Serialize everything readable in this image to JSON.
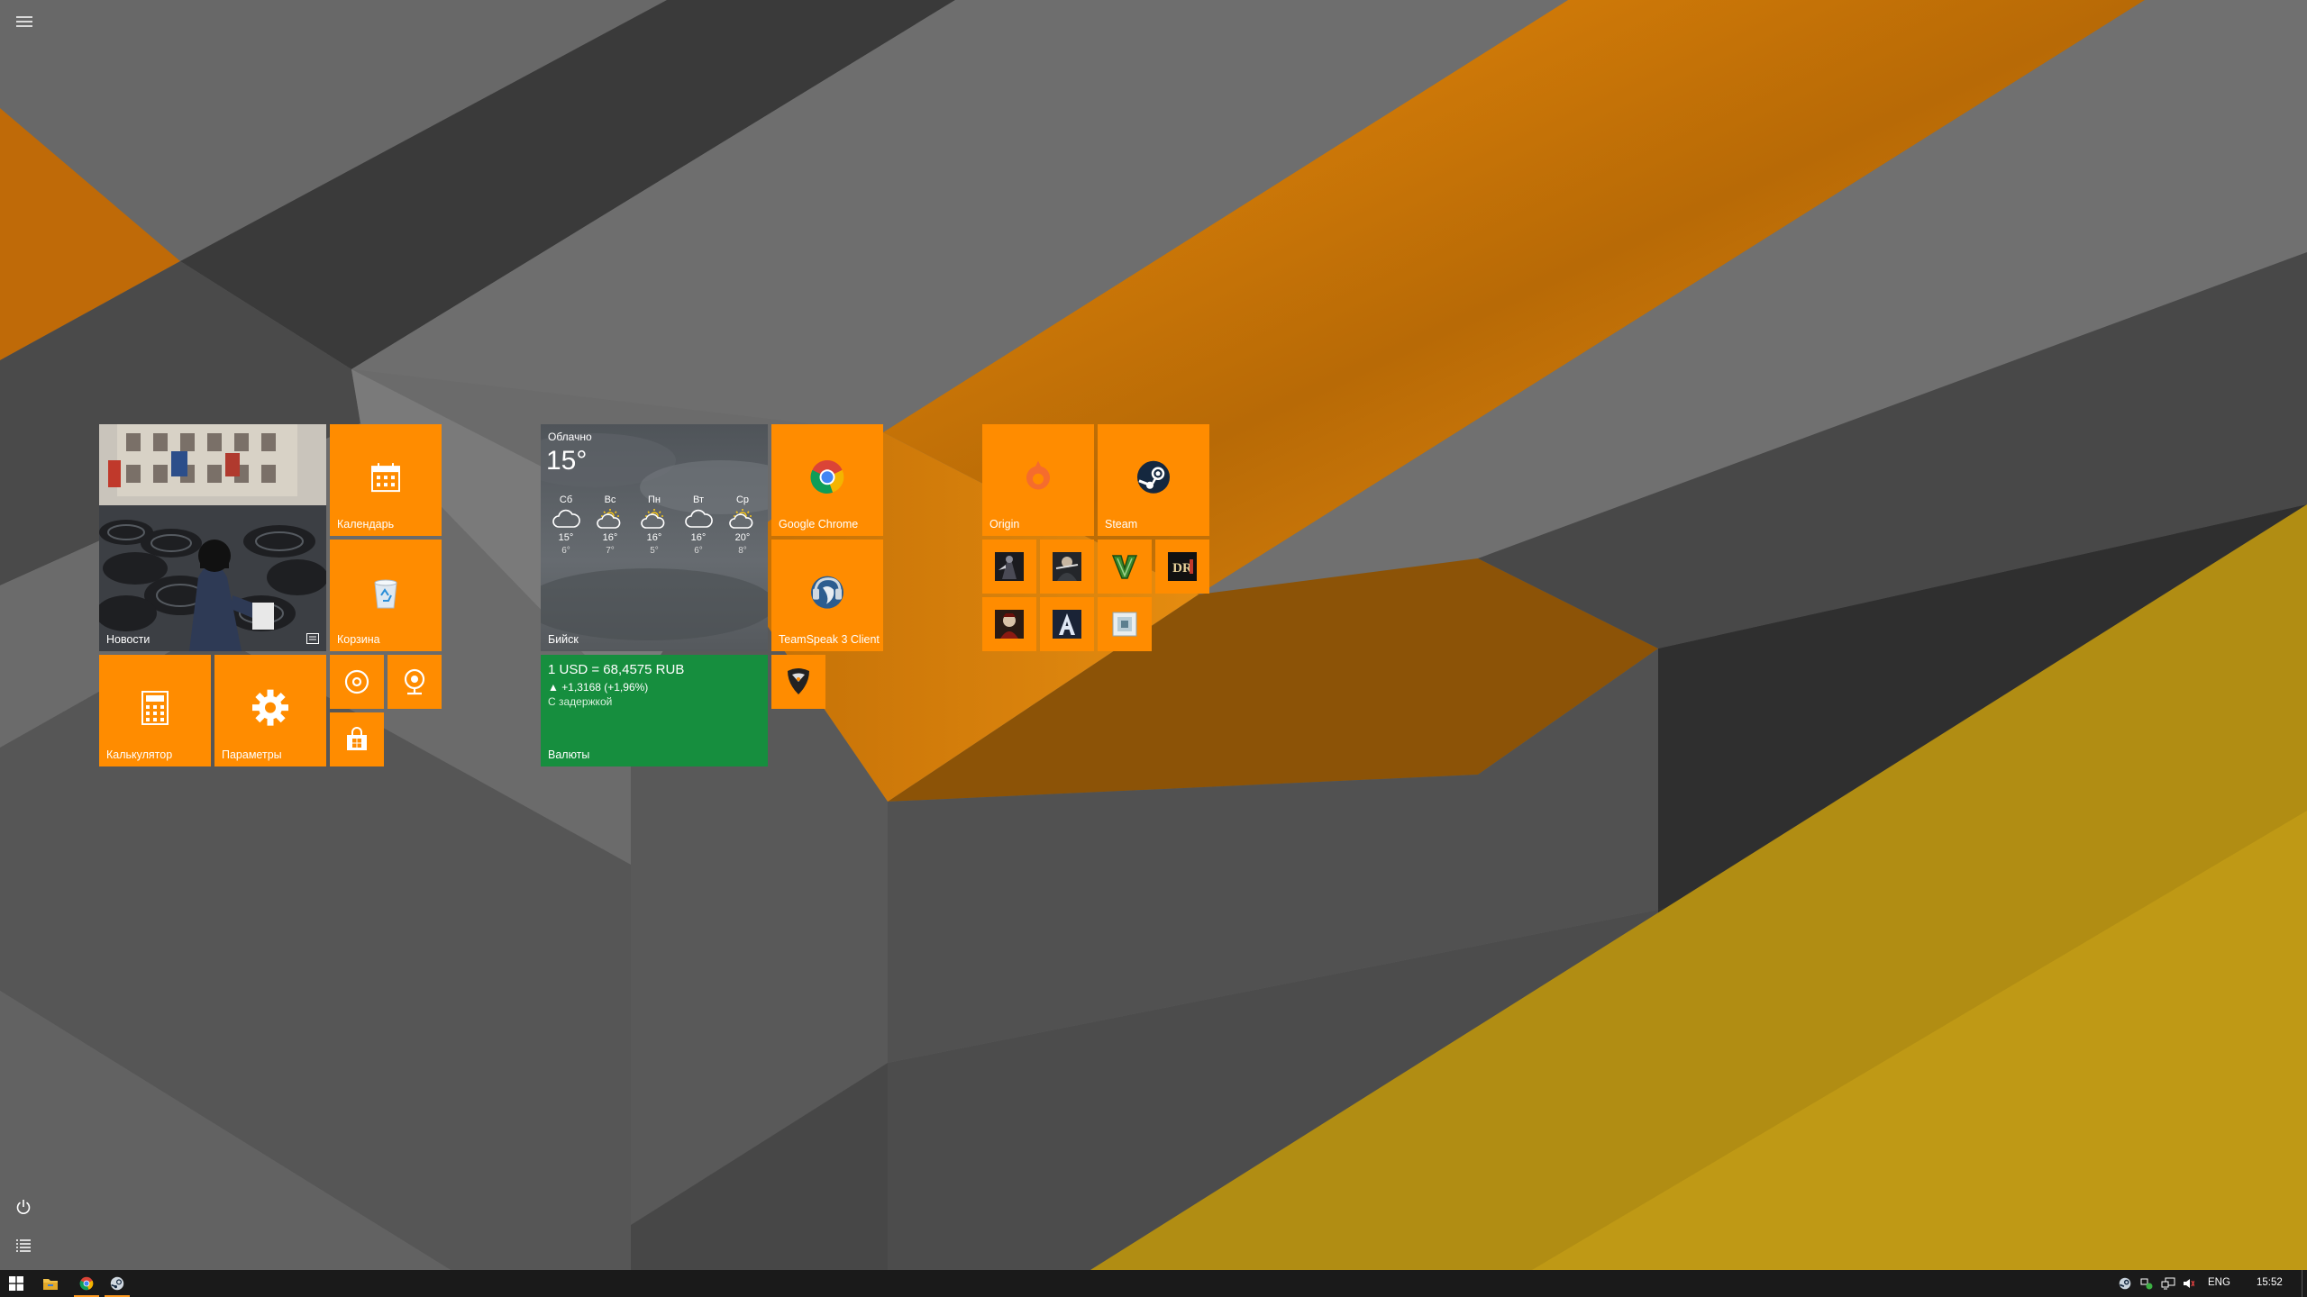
{
  "start": {
    "menu_icon": "hamburger-icon",
    "power_icon": "power-icon",
    "all_apps_icon": "all-apps-list-icon"
  },
  "colors": {
    "accent": "#FF8C00",
    "currency_tile": "#168E3E",
    "taskbar": "#1A1A1A",
    "weather_tile": "#5A5E63"
  },
  "tiles": {
    "news": {
      "label": "Новости",
      "badge_icon": "news-badge-icon"
    },
    "calendar": {
      "label": "Календарь",
      "icon": "calendar-icon"
    },
    "recycle_bin": {
      "label": "Корзина",
      "icon": "recycle-bin-icon"
    },
    "calculator": {
      "label": "Калькулятор",
      "icon": "calculator-icon"
    },
    "settings": {
      "label": "Параметры",
      "icon": "gear-icon"
    },
    "groove": {
      "icon": "music-disc-icon"
    },
    "camera": {
      "icon": "webcam-icon"
    },
    "store": {
      "icon": "store-bag-icon"
    },
    "chrome": {
      "label": "Google Chrome",
      "icon": "chrome-icon"
    },
    "teamspeak": {
      "label": "TeamSpeak 3 Client",
      "icon": "teamspeak-icon"
    },
    "guitar_app": {
      "icon": "guitar-pick-icon"
    },
    "origin": {
      "label": "Origin",
      "icon": "origin-icon"
    },
    "steam": {
      "label": "Steam",
      "icon": "steam-icon"
    },
    "games": [
      {
        "icon": "game-dark-figure-icon"
      },
      {
        "icon": "game-soldier-icon"
      },
      {
        "icon": "gta-v-icon"
      },
      {
        "icon": "dr-game-icon"
      },
      {
        "icon": "game-red-warrior-icon"
      },
      {
        "icon": "letter-a-game-icon"
      },
      {
        "icon": "game-white-box-icon"
      }
    ]
  },
  "weather": {
    "condition": "Облачно",
    "temp": "15°",
    "city": "Бийск",
    "days": [
      {
        "day": "Сб",
        "icon": "cloud-icon",
        "hi": "15°",
        "lo": "6°"
      },
      {
        "day": "Вс",
        "icon": "partly-sunny-icon",
        "hi": "16°",
        "lo": "7°"
      },
      {
        "day": "Пн",
        "icon": "partly-sunny-icon",
        "hi": "16°",
        "lo": "5°"
      },
      {
        "day": "Вт",
        "icon": "cloud-icon",
        "hi": "16°",
        "lo": "6°"
      },
      {
        "day": "Ср",
        "icon": "partly-sunny-icon",
        "hi": "20°",
        "lo": "8°"
      }
    ]
  },
  "currency": {
    "rate": "1 USD = 68,4575 RUB",
    "change": "▲ +1,3168 (+1,96%)",
    "delay": "С задержкой",
    "label": "Валюты"
  },
  "taskbar": {
    "start_icon": "windows-logo-icon",
    "apps": [
      {
        "name": "file-explorer",
        "icon": "folder-icon"
      },
      {
        "name": "chrome",
        "icon": "chrome-icon"
      },
      {
        "name": "steam",
        "icon": "steam-icon"
      }
    ],
    "tray_icons": [
      "steam-tray-icon",
      "network-status-icon",
      "network-icon",
      "volume-icon"
    ],
    "language": "ENG",
    "time": "15:52"
  }
}
